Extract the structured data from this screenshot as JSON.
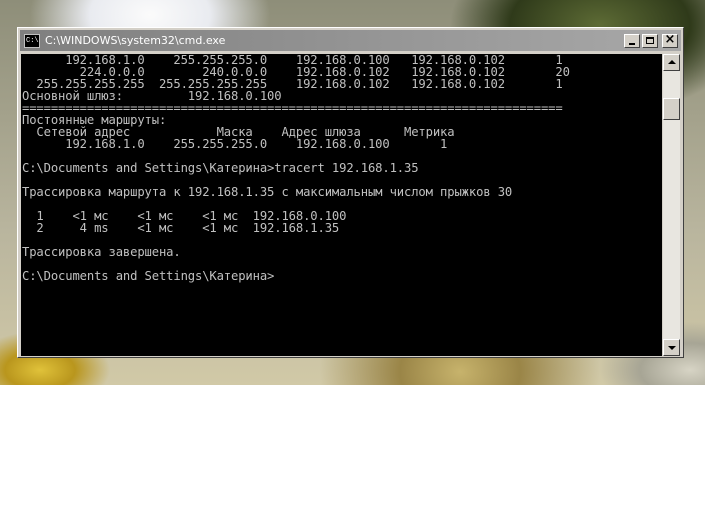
{
  "window": {
    "title": "C:\\WINDOWS\\system32\\cmd.exe",
    "icon_label": "C:\\"
  },
  "console": {
    "lines": [
      "      192.168.1.0    255.255.255.0    192.168.0.100   192.168.0.102       1",
      "        224.0.0.0        240.0.0.0    192.168.0.102   192.168.0.102       20",
      "  255.255.255.255  255.255.255.255    192.168.0.102   192.168.0.102       1",
      "Основной шлюз:         192.168.0.100",
      "===========================================================================",
      "Постоянные маршруты:",
      "  Сетевой адрес            Маска    Адрес шлюза      Метрика",
      "      192.168.1.0    255.255.255.0    192.168.0.100       1",
      "",
      "C:\\Documents and Settings\\Катерина>tracert 192.168.1.35",
      "",
      "Трассировка маршрута к 192.168.1.35 с максимальным числом прыжков 30",
      "",
      "  1    <1 мс    <1 мс    <1 мс  192.168.0.100",
      "  2     4 ms    <1 мс    <1 мс  192.168.1.35",
      "",
      "Трассировка завершена.",
      "",
      "C:\\Documents and Settings\\Катерина>"
    ]
  },
  "icons": {
    "app": "console-icon",
    "minimize": "minimize-icon",
    "maximize": "maximize-icon",
    "close": "close-icon",
    "scroll_up": "arrow-up-icon",
    "scroll_down": "arrow-down-icon"
  },
  "colors": {
    "console_bg": "#000000",
    "console_fg": "#c0c0c0",
    "titlebar": "#8a8a8a",
    "chrome": "#d4d0c8"
  }
}
